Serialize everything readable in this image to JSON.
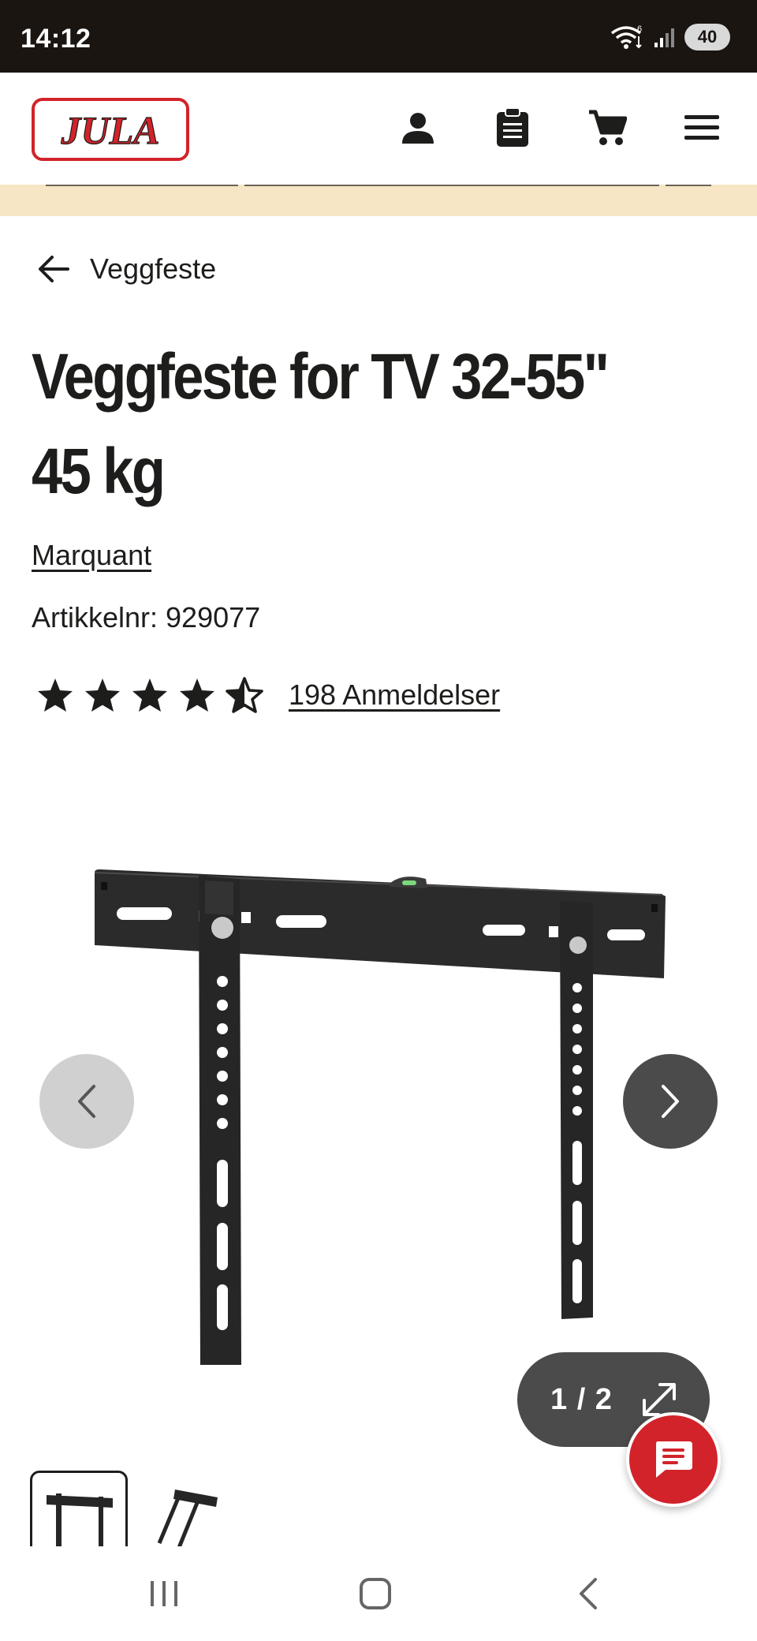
{
  "status_bar": {
    "time": "14:12",
    "battery": "40",
    "icons": [
      "wifi-icon",
      "signal-icon",
      "battery-icon"
    ]
  },
  "header": {
    "logo_text": "JULA",
    "icons": [
      "user-icon",
      "clipboard-icon",
      "cart-icon",
      "menu-icon"
    ]
  },
  "breadcrumb": {
    "back_label": "Veggfeste"
  },
  "product": {
    "title_line1": "Veggfeste for TV 32-55\"",
    "title_line2": "45 kg",
    "brand": "Marquant",
    "article_number": "Artikkelnr: 929077",
    "rating": 4.5,
    "rating_max": 5,
    "reviews_label": "198 Anmeldelser"
  },
  "gallery": {
    "counter": "1 / 2",
    "current": 1,
    "total": 2
  },
  "colors": {
    "brand_red": "#d2232a",
    "promo_strip": "#f7e6c5",
    "status_bar": "#1b1512",
    "dark_button": "#4b4b4b"
  }
}
